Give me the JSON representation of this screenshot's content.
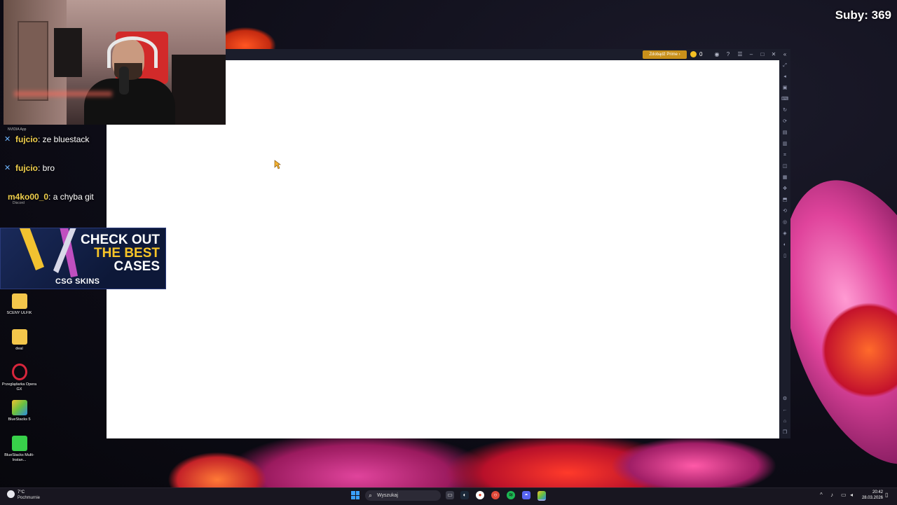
{
  "overlay": {
    "subs_text": "Suby: 369"
  },
  "chat": {
    "tiny_label": "NVIDIA App",
    "messages": [
      {
        "user": "fujcio",
        "text": ": ze bluestack"
      },
      {
        "user": "fujcio",
        "text": ": bro"
      },
      {
        "user": "m4ko00_0",
        "text": ": a chyba git"
      }
    ],
    "discord_label": "Discord"
  },
  "ad": {
    "line1": "CHECK OUT",
    "line2": "THE BEST",
    "line3": "CASES",
    "brand": "CSG SKINS"
  },
  "desktop_icons": [
    {
      "label": "SCENY ULFIK",
      "icon": "folder-icon",
      "color": "#f3c64b"
    },
    {
      "label": "deal",
      "icon": "folder-icon",
      "color": "#f3c64b"
    },
    {
      "label": "Przeglądarka Opera GX",
      "icon": "opera-gx-icon",
      "color": "#d8263c"
    },
    {
      "label": "BlueStacks 5",
      "icon": "bluestacks-icon",
      "color": "#6ac040"
    },
    {
      "label": "BlueStacks Multi-Instan...",
      "icon": "bluestacks-multi-icon",
      "color": "#38d04a"
    }
  ],
  "bluestacks": {
    "prime_label": "Zdobądź Prime ›",
    "coin_count": "0",
    "accent": "#c9901a"
  },
  "taskbar": {
    "weather_temp": "7°C",
    "weather_desc": "Pochmurnie",
    "search_placeholder": "Wyszukaj",
    "clock_time": "20:42",
    "clock_date": "28.03.2026"
  }
}
